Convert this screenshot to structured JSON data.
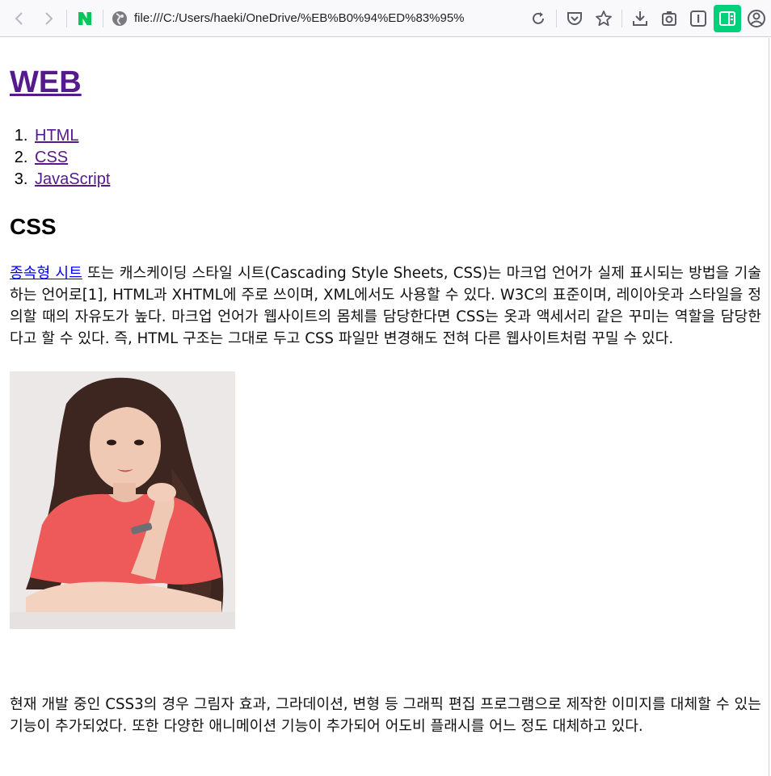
{
  "browser": {
    "url": "file:///C:/Users/haeki/OneDrive/%EB%B0%94%ED%83%95%"
  },
  "page": {
    "site_title": "WEB",
    "nav_items": [
      "HTML",
      "CSS",
      "JavaScript"
    ],
    "section_title": "CSS",
    "paragraph1_link": "종속형 시트",
    "paragraph1_rest": " 또는 캐스케이딩 스타일 시트(Cascading Style Sheets, CSS)는 마크업 언어가 실제 표시되는 방법을 기술하는 언어로[1], HTML과 XHTML에 주로 쓰이며, XML에서도 사용할 수 있다. W3C의 표준이며, 레이아웃과 스타일을 정의할 때의 자유도가 높다. 마크업 언어가 웹사이트의 몸체를 담당한다면 CSS는 옷과 액세서리 같은 꾸미는 역할을 담당한다고 할 수 있다. 즉, HTML 구조는 그대로 두고 CSS 파일만 변경해도 전혀 다른 웹사이트처럼 꾸밀 수 있다.",
    "paragraph2": "현재 개발 중인 CSS3의 경우 그림자 효과, 그라데이션, 변형 등 그래픽 편집 프로그램으로 제작한 이미지를 대체할 수 있는 기능이 추가되었다. 또한 다양한 애니메이션 기능이 추가되어 어도비 플래시를 어느 정도 대체하고 있다."
  },
  "icons": {
    "back": "back-arrow-icon",
    "forward": "forward-arrow-icon",
    "naver": "naver-icon",
    "site": "site-identity-icon",
    "reload": "reload-icon",
    "pocket": "pocket-icon",
    "bookmark": "star-icon",
    "downloads": "download-icon",
    "screenshot": "screenshot-icon",
    "extension": "extension-icon",
    "sidebar": "sidebar-icon",
    "account": "account-icon"
  },
  "colors": {
    "visited_link": "#551a8b",
    "link": "#0000ee",
    "naver_green": "#03c75a",
    "active_extension": "#00d17a"
  }
}
